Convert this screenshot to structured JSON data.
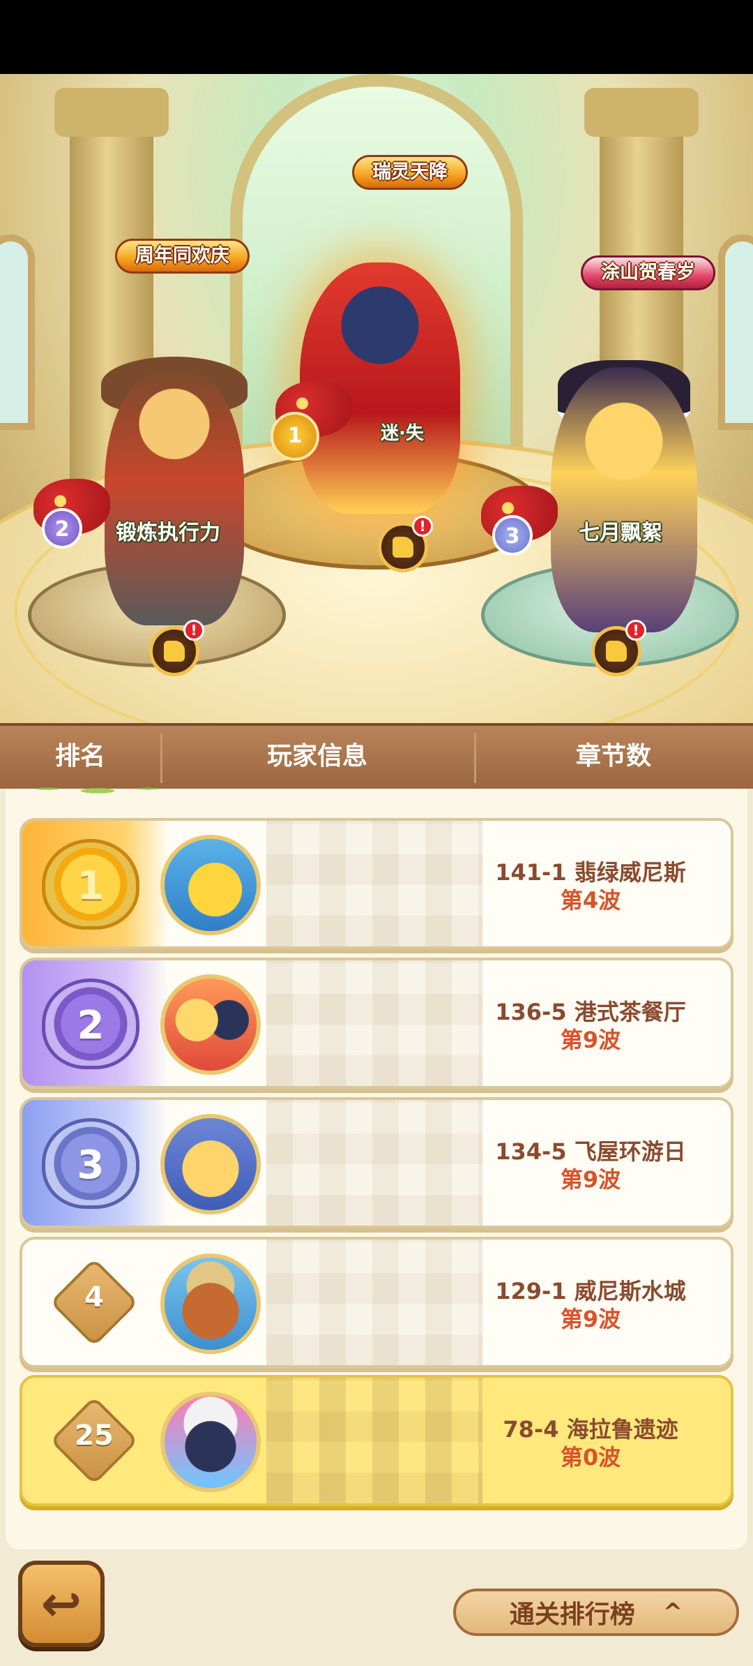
{
  "podium": {
    "first": {
      "title": "瑞灵天降",
      "name": "迷·失",
      "place": "1"
    },
    "second": {
      "title": "周年同欢庆",
      "name": "锻炼执行力",
      "place": "2"
    },
    "third": {
      "title": "涂山贺春岁",
      "name": "七月飘絮",
      "place": "3"
    },
    "like_alert": "!"
  },
  "table": {
    "headers": {
      "rank": "排名",
      "player": "玩家信息",
      "chapter": "章节数"
    },
    "rows": [
      {
        "rank": "1",
        "medal": "gold",
        "chapter": "141-1 翡绿威尼斯",
        "wave": "第4波",
        "avatar_icon": "duck-avatar-icon"
      },
      {
        "rank": "2",
        "medal": "purple",
        "chapter": "136-5 港式茶餐厅",
        "wave": "第9波",
        "avatar_icon": "duo-heroes-avatar-icon"
      },
      {
        "rank": "3",
        "medal": "blue",
        "chapter": "134-5 飞屋环游日",
        "wave": "第9波",
        "avatar_icon": "witch-avatar-icon"
      },
      {
        "rank": "4",
        "medal": "diamond",
        "chapter": "129-1 威尼斯水城",
        "wave": "第9波",
        "avatar_icon": "bear-explorer-avatar-icon"
      },
      {
        "rank": "25",
        "medal": "diamond",
        "chapter": "78-4 海拉鲁遗迹",
        "wave": "第0波",
        "avatar_icon": "clown-avatar-icon",
        "is_self": true
      }
    ]
  },
  "bottom": {
    "back_icon": "back-arrow-icon",
    "leaderboard_label": "通关排行榜",
    "leaderboard_chevron": "^"
  },
  "colors": {
    "chapter_text": "#8b4a2e",
    "wave_text": "#d8532a",
    "self_row": "#ffe97d",
    "header_bg": "#9b6640"
  }
}
